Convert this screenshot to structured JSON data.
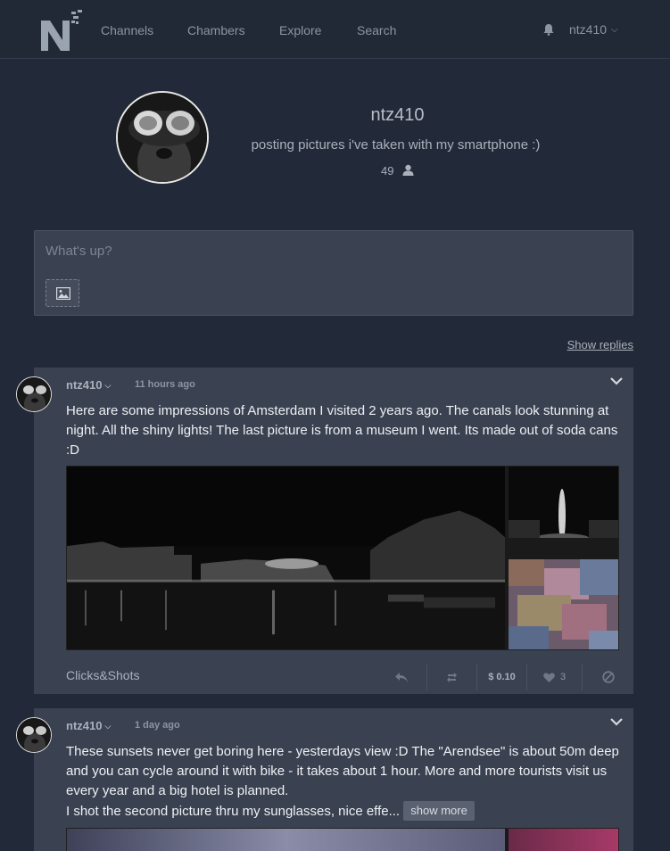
{
  "colors": {
    "background": "#222938",
    "card": "#3a4252",
    "text": "#eef0f3",
    "muted": "#8c95a4"
  },
  "nav": {
    "logo": "NF",
    "links": [
      "Channels",
      "Chambers",
      "Explore",
      "Search"
    ],
    "username": "ntz410",
    "bell_icon": "bell-icon",
    "user_chevron_icon": "chevron-down-icon"
  },
  "profile": {
    "name": "ntz410",
    "bio": "posting pictures i've taken with my smartphone :)",
    "followers": "49",
    "followers_icon": "user-icon"
  },
  "composer": {
    "placeholder": "What's up?",
    "image_icon": "image-icon"
  },
  "show_replies": "Show replies",
  "posts": [
    {
      "author": "ntz410",
      "time": "11 hours ago",
      "text": "Here are some impressions of Amsterdam I visited 2 years ago. The canals look stunning at night. All the shiny lights! The last picture is from a museum I went. Its made out of soda cans :D",
      "community": "Clicks&Shots",
      "tip": "$ 0.10",
      "likes": "3",
      "icons": [
        "reply-icon",
        "repost-icon",
        "heart-icon",
        "block-icon"
      ]
    },
    {
      "author": "ntz410",
      "time": "1 day ago",
      "text_line1": "These sunsets never get boring here - yesterdays view :D The \"Arendsee\" is about 50m deep and you can cycle around it with bike - it takes about 1 hour. More and more tourists visit us every year and a big hotel is planned.",
      "text_line2": "I shot the second picture thru my sunglasses, nice effe...",
      "show_more": "show more"
    }
  ]
}
